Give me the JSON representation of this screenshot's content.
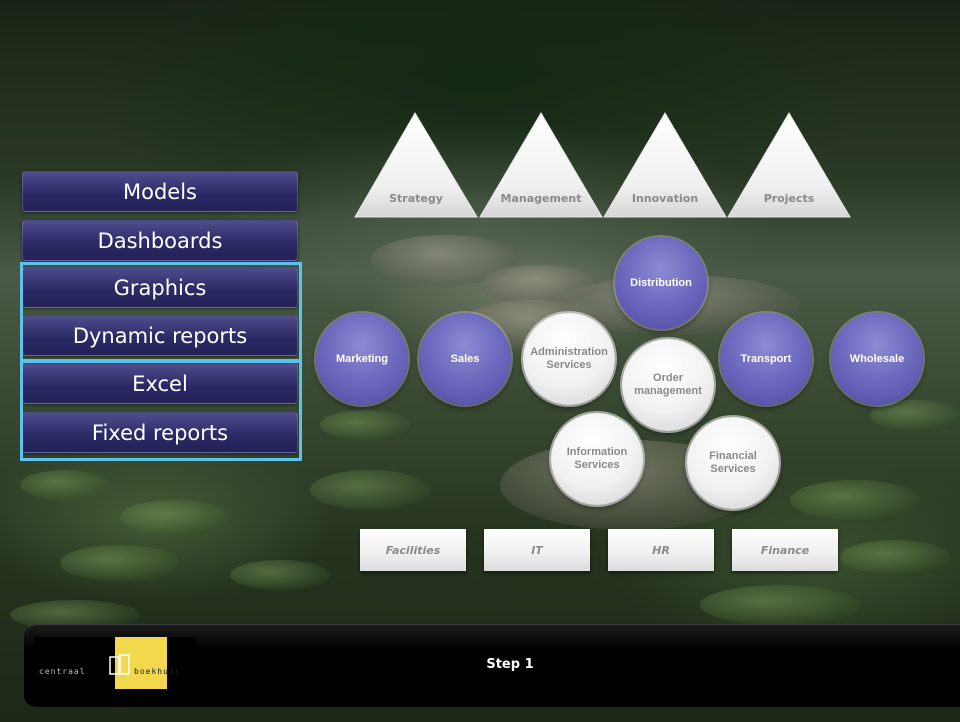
{
  "menu": {
    "items": [
      {
        "label": "Models"
      },
      {
        "label": "Dashboards"
      },
      {
        "label": "Graphics"
      },
      {
        "label": "Dynamic reports"
      },
      {
        "label": "Excel"
      },
      {
        "label": "Fixed reports"
      }
    ]
  },
  "pillars": [
    {
      "label": "Strategy"
    },
    {
      "label": "Management"
    },
    {
      "label": "Innovation"
    },
    {
      "label": "Projects"
    }
  ],
  "processes": {
    "distribution": "Distribution",
    "marketing": "Marketing",
    "sales": "Sales",
    "administration": "Administration Services",
    "order_management": "Order management",
    "transport": "Transport",
    "wholesale": "Wholesale",
    "information": "Information Services",
    "financial": "Financial Services"
  },
  "support": [
    {
      "label": "Facilities"
    },
    {
      "label": "IT"
    },
    {
      "label": "HR"
    },
    {
      "label": "Finance"
    }
  ],
  "footer": {
    "logo_left": "centraal",
    "logo_right": "boekhuis",
    "step": "Step 1"
  },
  "colors": {
    "menu_blue": "#2c2a66",
    "highlight_border": "#5bc4ec",
    "purple_bubble": "#6b68bd",
    "logo_yellow": "#f2d84c"
  }
}
